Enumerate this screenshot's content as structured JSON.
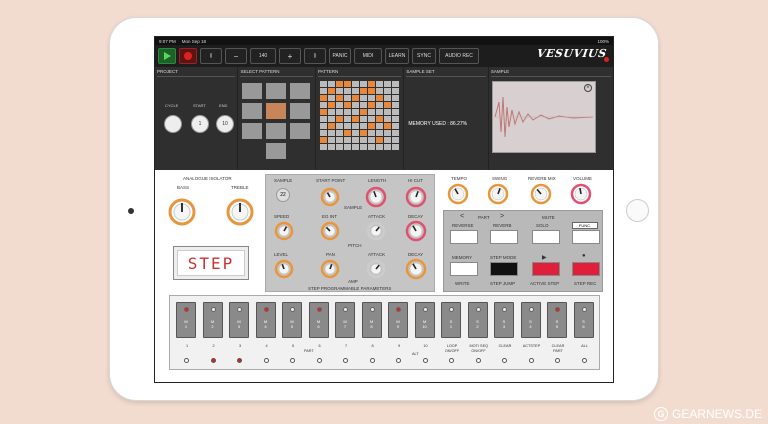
{
  "status": {
    "time": "9:07 PM",
    "date": "Mon Sep 18",
    "battery": "100%"
  },
  "toolbar": {
    "tempo_rewind": "⟪",
    "minus": "−",
    "tempo": "140",
    "plus": "+",
    "fforward": "⟫",
    "panic": "PANIC",
    "midi": "MIDI",
    "learn": "LEARN",
    "sync": "SYNC",
    "audiorec": "AUDIO REC",
    "logo": "VESUVIUS"
  },
  "project": {
    "title": "PROJECT",
    "cycle": "CYCLE",
    "start": "START",
    "end": "END",
    "start_val": "1",
    "end_val": "10",
    "preset": "Demo"
  },
  "pattern_select": {
    "title": "SELECT PATTERN"
  },
  "pattern": {
    "title": "PATTERN",
    "preset": "M5"
  },
  "sample_set": {
    "title": "SAMPLE SET",
    "memory": "MEMORY USED : 86.27%",
    "preset": "Demo"
  },
  "sample": {
    "title": "SAMPLE",
    "preset": "Hat_07"
  },
  "isolator": {
    "title": "ANALOGUE ISOLATOR",
    "bass": "BASS",
    "treble": "TREBLE",
    "display": "STEP"
  },
  "params": {
    "sample": "SAMPLE",
    "sample_val": "22",
    "start_point": "START POINT",
    "length": "LENGTH",
    "hicut": "HI CUT",
    "sample2": "SAMPLE",
    "speed": "SPEED",
    "eg_int": "EG INT",
    "attack": "ATTACK",
    "decay": "DECAY",
    "pitch": "PITCH",
    "level": "LEVEL",
    "pan": "PAN",
    "attack2": "ATTACK",
    "decay2": "DECAY",
    "amp": "AMP",
    "footer": "STEP PROGRAMMABLE PARAMETERS"
  },
  "fx": {
    "tempo": "TEMPO",
    "swing": "SWING",
    "reverb_mix": "REVERB MIX",
    "volume": "VOLUME"
  },
  "controls": {
    "part_prev": "<",
    "part": "PART",
    "part_next": ">",
    "mute": "MUTE",
    "reverse": "REVERSE",
    "reverb": "REVERB",
    "solo": "SOLO",
    "func": "FUNC.",
    "memory": "MEMORY",
    "step_mode": "STEP MODE",
    "write": "WRITE",
    "step_jump": "STEP JUMP",
    "active_step": "ACTIVE STEP",
    "step_rec": "STEP REC"
  },
  "pads": [
    {
      "a": "M",
      "b": "1",
      "red": true
    },
    {
      "a": "M",
      "b": "2",
      "red": false
    },
    {
      "a": "M",
      "b": "3",
      "red": false
    },
    {
      "a": "M",
      "b": "4",
      "red": true
    },
    {
      "a": "M",
      "b": "5",
      "red": false
    },
    {
      "a": "M",
      "b": "6",
      "red": true
    },
    {
      "a": "M",
      "b": "7",
      "red": false
    },
    {
      "a": "M",
      "b": "8",
      "red": false
    },
    {
      "a": "M",
      "b": "9",
      "red": true
    },
    {
      "a": "M",
      "b": "10",
      "red": false
    },
    {
      "a": "S",
      "b": "1",
      "red": false
    },
    {
      "a": "S",
      "b": "2",
      "red": false
    },
    {
      "a": "S",
      "b": "3",
      "red": false
    },
    {
      "a": "S",
      "b": "4",
      "red": false
    },
    {
      "a": "S",
      "b": "5",
      "red": true
    },
    {
      "a": "S",
      "b": "6",
      "red": false
    }
  ],
  "steps": [
    {
      "n": "1",
      "on": false
    },
    {
      "n": "2",
      "on": true
    },
    {
      "n": "3",
      "on": true
    },
    {
      "n": "4",
      "on": false
    },
    {
      "n": "5",
      "on": false
    },
    {
      "n": "6",
      "on": false
    },
    {
      "n": "7",
      "on": false
    },
    {
      "n": "8",
      "on": false
    },
    {
      "n": "9",
      "on": false
    },
    {
      "n": "10",
      "on": false
    },
    {
      "n": "LOOP\nON/OFF",
      "on": false
    },
    {
      "n": "MOTI SEQ\nON/OFF",
      "on": false
    },
    {
      "n": "CLEAR",
      "on": false
    },
    {
      "n": "ACTSTEP",
      "on": false
    },
    {
      "n": "CLEAR\nPART",
      "on": false
    },
    {
      "n": "ALL",
      "on": false
    }
  ],
  "seq_labels": {
    "part": "PART",
    "alt": "ALT"
  },
  "watermark": "GEARNEWS.DE",
  "colors": {
    "accent_red": "#e02020",
    "knob_orange": "#e8963e",
    "knob_pink": "#e05070",
    "pattern_orange": "#e8883a"
  }
}
